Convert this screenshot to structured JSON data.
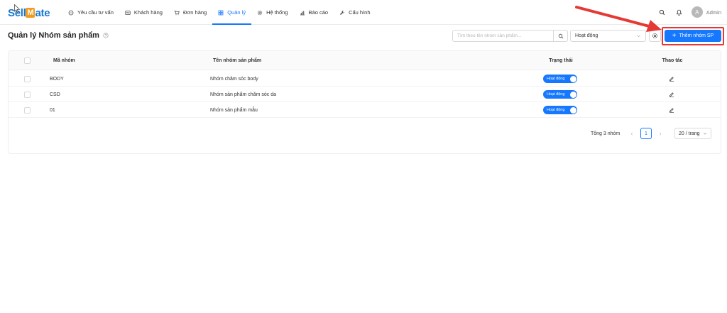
{
  "app": {
    "logo_part1": "Sell",
    "logo_part2": "M",
    "logo_part3": "ate"
  },
  "nav": {
    "items": [
      {
        "label": "Yêu cầu tư vấn",
        "icon": "chat-icon",
        "active": false
      },
      {
        "label": "Khách hàng",
        "icon": "contact-card-icon",
        "active": false
      },
      {
        "label": "Đơn hàng",
        "icon": "cart-icon",
        "active": false
      },
      {
        "label": "Quản lý",
        "icon": "grid-icon",
        "active": true
      },
      {
        "label": "Hệ thống",
        "icon": "gear-icon",
        "active": false
      },
      {
        "label": "Báo cáo",
        "icon": "bar-chart-icon",
        "active": false
      },
      {
        "label": "Cấu hình",
        "icon": "wrench-icon",
        "active": false
      }
    ]
  },
  "user": {
    "avatar_initial": "A",
    "name": "Admin"
  },
  "page": {
    "title": "Quản lý Nhóm sản phẩm"
  },
  "toolbar": {
    "search_placeholder": "Tìm theo tên nhóm sản phẩm...",
    "status_value": "Hoạt động",
    "add_label": "Thêm nhóm SP"
  },
  "table": {
    "columns": {
      "code": "Mã nhóm",
      "name": "Tên nhóm sản phẩm",
      "status": "Trạng thái",
      "actions": "Thao tác"
    },
    "rows": [
      {
        "code": "BODY",
        "name": "Nhóm chăm sóc body",
        "status": "Hoạt động"
      },
      {
        "code": "CSD",
        "name": "Nhóm sản phẩm chăm sóc da",
        "status": "Hoạt động"
      },
      {
        "code": "01",
        "name": "Nhóm sản phẩm mẫu",
        "status": "Hoạt động"
      }
    ]
  },
  "pagination": {
    "total_text": "Tổng 3 nhóm",
    "prev": "‹",
    "current_page": "1",
    "next": "›",
    "page_size": "20 / trang"
  },
  "colors": {
    "primary": "#1677ff",
    "highlight": "#e53935",
    "logo_orange": "#f39a1e"
  }
}
